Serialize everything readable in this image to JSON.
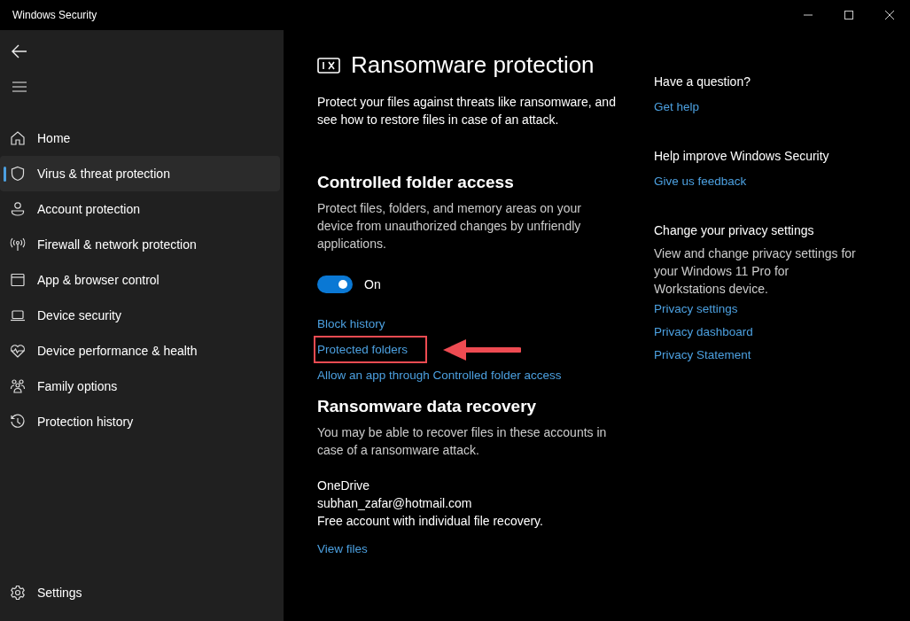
{
  "window": {
    "title": "Windows Security"
  },
  "sidebar": {
    "items": [
      {
        "label": "Home",
        "selected": false
      },
      {
        "label": "Virus & threat protection",
        "selected": true
      },
      {
        "label": "Account protection",
        "selected": false
      },
      {
        "label": "Firewall & network protection",
        "selected": false
      },
      {
        "label": "App & browser control",
        "selected": false
      },
      {
        "label": "Device security",
        "selected": false
      },
      {
        "label": "Device performance & health",
        "selected": false
      },
      {
        "label": "Family options",
        "selected": false
      },
      {
        "label": "Protection history",
        "selected": false
      }
    ],
    "settings": "Settings"
  },
  "page": {
    "title": "Ransomware protection",
    "description": "Protect your files against threats like ransomware, and see how to restore files in case of an attack."
  },
  "controlled_folder_access": {
    "heading": "Controlled folder access",
    "description": "Protect files, folders, and memory areas on your device from unauthorized changes by unfriendly applications.",
    "toggle": {
      "on": true,
      "label": "On"
    },
    "links": [
      {
        "label": "Block history",
        "highlighted": false
      },
      {
        "label": "Protected folders",
        "highlighted": true
      },
      {
        "label": "Allow an app through Controlled folder access",
        "highlighted": false
      }
    ]
  },
  "data_recovery": {
    "heading": "Ransomware data recovery",
    "description": "You may be able to recover files in these accounts in case of a ransomware attack.",
    "provider": "OneDrive",
    "account": "subhan_zafar@hotmail.com",
    "plan": "Free account with individual file recovery.",
    "link": "View files"
  },
  "aside": [
    {
      "heading": "Have a question?",
      "links": [
        "Get help"
      ]
    },
    {
      "heading": "Help improve Windows Security",
      "links": [
        "Give us feedback"
      ]
    },
    {
      "heading": "Change your privacy settings",
      "text": "View and change privacy settings for your Windows 11 Pro for Workstations device.",
      "links": [
        "Privacy settings",
        "Privacy dashboard",
        "Privacy Statement"
      ]
    }
  ]
}
